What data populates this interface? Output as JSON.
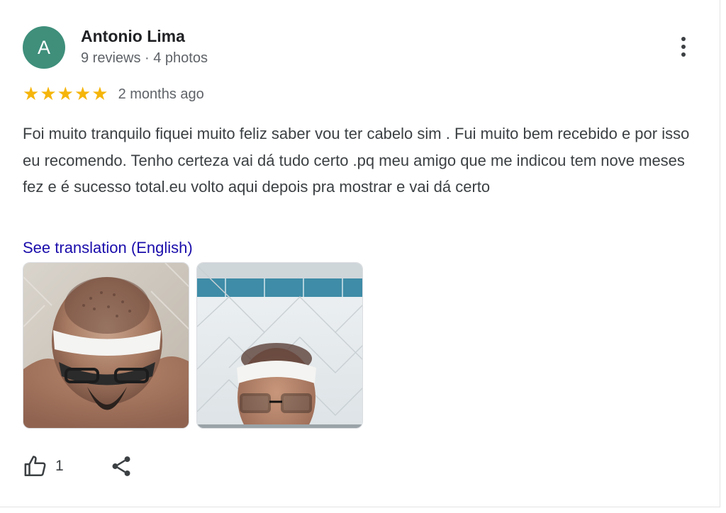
{
  "review": {
    "author": {
      "initial": "A",
      "name": "Antonio Lima",
      "meta": "9 reviews · 4 photos",
      "avatar_color": "#3f8f7b"
    },
    "rating": 5,
    "rating_max": 5,
    "date": "2 months ago",
    "text": "Foi muito tranquilo fiquei muito feliz saber vou ter cabelo sim . Fui muito bem recebido e por isso eu recomendo. Tenho certeza vai dá tudo certo .pq meu amigo que me indicou tem nove meses fez e é sucesso total.eu volto aqui depois pra mostrar e vai dá certo",
    "translate_link": "See translation (English)",
    "photos": [
      "photo-top-of-head",
      "photo-front-face"
    ],
    "likes": "1"
  },
  "icons": {
    "more": "more-vert-icon",
    "like": "thumb-up-icon",
    "share": "share-icon",
    "star": "star-icon"
  },
  "colors": {
    "star": "#f5b50a",
    "link": "#1a0dab",
    "secondary_text": "#5f6368"
  }
}
